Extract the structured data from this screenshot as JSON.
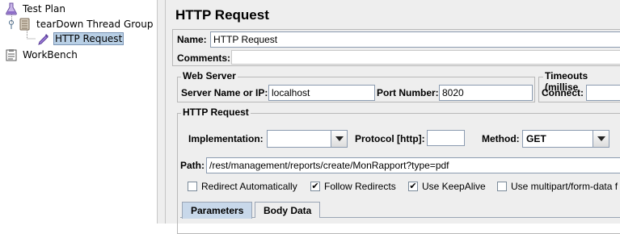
{
  "tree": {
    "items": [
      {
        "label": "Test Plan",
        "icon": "flask-icon"
      },
      {
        "label": "tearDown Thread Group",
        "icon": "thread-group-icon"
      },
      {
        "label": "HTTP Request",
        "icon": "pipette-icon"
      },
      {
        "label": "WorkBench",
        "icon": "clipboard-icon"
      }
    ]
  },
  "panel": {
    "title": "HTTP Request",
    "name_label": "Name:",
    "name_value": "HTTP Request",
    "comments_label": "Comments:",
    "web_server": {
      "title": "Web Server",
      "server_label": "Server Name or IP:",
      "server_value": "localhost",
      "port_label": "Port Number:",
      "port_value": "8020"
    },
    "timeouts": {
      "title": "Timeouts (millise",
      "connect_label": "Connect:",
      "connect_value": ""
    },
    "http_request": {
      "title": "HTTP Request",
      "implementation_label": "Implementation:",
      "implementation_value": "",
      "protocol_label": "Protocol [http]:",
      "protocol_value": "",
      "method_label": "Method:",
      "method_value": "GET",
      "path_label": "Path:",
      "path_value": "/rest/management/reports/create/MonRapport?type=pdf"
    },
    "checkboxes": [
      {
        "label": "Redirect Automatically",
        "checked": false
      },
      {
        "label": "Follow Redirects",
        "checked": true
      },
      {
        "label": "Use KeepAlive",
        "checked": true
      },
      {
        "label": "Use multipart/form-data f",
        "checked": false
      }
    ],
    "tabs": [
      "Parameters",
      "Body Data"
    ],
    "check_mark": "✔"
  },
  "colors": {
    "selection": "#b8cfe5",
    "panel_bg": "#eeeeee",
    "tab_active": "#c8d8ea"
  }
}
